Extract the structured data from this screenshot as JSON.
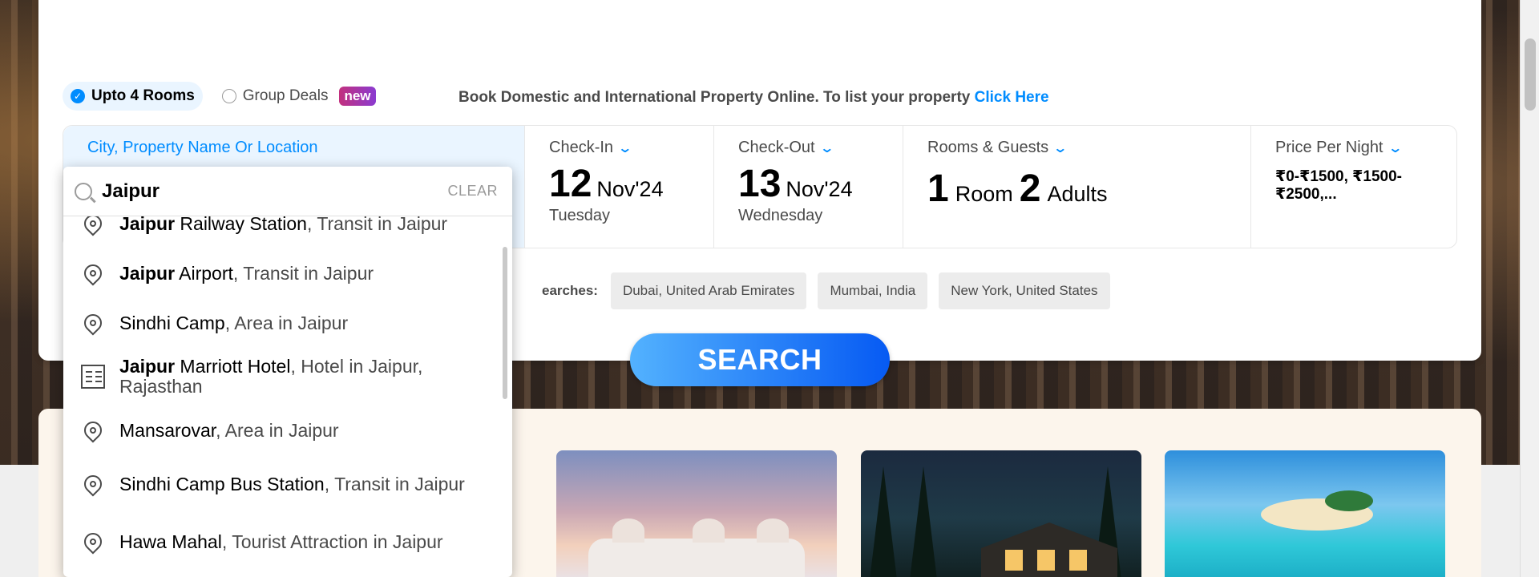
{
  "tabs": {
    "rooms_label": "Upto 4 Rooms",
    "group_label": "Group Deals",
    "new_badge": "new"
  },
  "promo": {
    "text": "Book Domestic and International Property Online. To list your property ",
    "link": "Click Here"
  },
  "search": {
    "city_label": "City, Property Name Or Location",
    "checkin": {
      "label": "Check-In",
      "day": "12",
      "month": "Nov'24",
      "weekday": "Tuesday"
    },
    "checkout": {
      "label": "Check-Out",
      "day": "13",
      "month": "Nov'24",
      "weekday": "Wednesday"
    },
    "rooms": {
      "label": "Rooms & Guests",
      "rooms_count": "1",
      "rooms_word": "Room",
      "adults_count": "2",
      "adults_word": "Adults"
    },
    "price": {
      "label": "Price Per Night",
      "value": "₹0-₹1500, ₹1500-₹2500,..."
    },
    "button": "SEARCH"
  },
  "recent": {
    "label": "earches:",
    "chips": [
      "Dubai, United Arab Emirates",
      "Mumbai, India",
      "New York, United States"
    ]
  },
  "dropdown": {
    "value": "Jaipur",
    "clear": "CLEAR",
    "items": [
      {
        "hl": "Jaipur",
        "name": " Railway Station",
        "desc": ", Transit in Jaipur",
        "icon": "location-pin-icon"
      },
      {
        "hl": "Jaipur",
        "name": " Airport",
        "desc": ", Transit in Jaipur",
        "icon": "location-pin-icon"
      },
      {
        "hl": "",
        "name": "Sindhi Camp",
        "desc": ", Area in Jaipur",
        "icon": "location-pin-icon"
      },
      {
        "hl": "Jaipur",
        "name": " Marriott Hotel",
        "desc": ", Hotel in Jaipur, Rajasthan",
        "icon": "hotel-icon"
      },
      {
        "hl": "",
        "name": "Mansarovar",
        "desc": ", Area in Jaipur",
        "icon": "location-pin-icon"
      },
      {
        "hl": "",
        "name": "Sindhi Camp Bus Station",
        "desc": ", Transit in Jaipur",
        "icon": "location-pin-icon"
      },
      {
        "hl": "",
        "name": "Hawa Mahal",
        "desc": ", Tourist Attraction in Jaipur",
        "icon": "location-pin-icon"
      }
    ]
  },
  "colors": {
    "accent": "#008cff",
    "button_start": "#53b2fe",
    "button_end": "#065af3"
  }
}
